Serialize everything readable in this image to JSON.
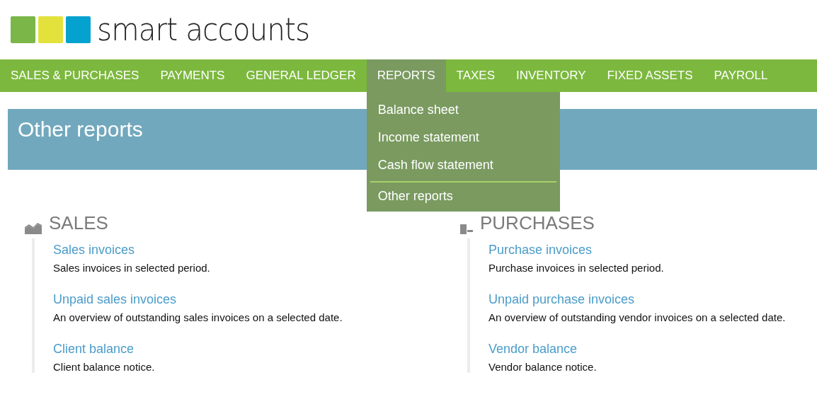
{
  "logo": {
    "text": "smart accounts"
  },
  "nav": [
    {
      "label": "SALES & PURCHASES",
      "selected": false
    },
    {
      "label": "PAYMENTS",
      "selected": false
    },
    {
      "label": "GENERAL LEDGER",
      "selected": false
    },
    {
      "label": "REPORTS",
      "selected": true
    },
    {
      "label": "TAXES",
      "selected": false
    },
    {
      "label": "INVENTORY",
      "selected": false
    },
    {
      "label": "FIXED ASSETS",
      "selected": false
    },
    {
      "label": "PAYROLL",
      "selected": false
    }
  ],
  "dropdown": [
    {
      "label": "Balance sheet",
      "divider_before": false
    },
    {
      "label": "Income statement",
      "divider_before": false
    },
    {
      "label": "Cash flow statement",
      "divider_before": false
    },
    {
      "label": "Other reports",
      "divider_before": true
    }
  ],
  "page_title": "Other reports",
  "sections": [
    {
      "title": "SALES",
      "kind": "sales",
      "items": [
        {
          "link": "Sales invoices",
          "description": "Sales invoices in selected period."
        },
        {
          "link": "Unpaid sales invoices",
          "description": "An overview of outstanding sales invoices on a selected date."
        },
        {
          "link": "Client balance",
          "description": "Client balance notice."
        }
      ]
    },
    {
      "title": "PURCHASES",
      "kind": "purchases",
      "items": [
        {
          "link": "Purchase invoices",
          "description": "Purchase invoices in selected period."
        },
        {
          "link": "Unpaid purchase invoices",
          "description": "An overview of outstanding vendor invoices on a selected date."
        },
        {
          "link": "Vendor balance",
          "description": "Vendor balance notice."
        }
      ]
    }
  ]
}
